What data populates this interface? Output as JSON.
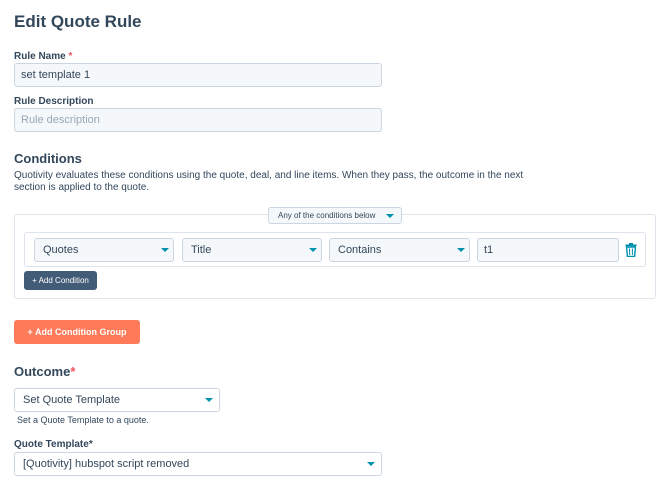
{
  "page": {
    "title": "Edit Quote Rule"
  },
  "rule_name": {
    "label": "Rule Name",
    "required_mark": "*",
    "value": "set template 1"
  },
  "rule_description": {
    "label": "Rule Description",
    "placeholder": "Rule description"
  },
  "conditions": {
    "heading": "Conditions",
    "description_line1": "Quotivity evaluates these conditions using the quote, deal, and line items. When they pass, the outcome in the next",
    "description_line2": "section is applied to the quote.",
    "group": {
      "match_selector": "Any of the conditions below",
      "row": {
        "object": "Quotes",
        "property": "Title",
        "operator": "Contains",
        "value": "t1"
      },
      "add_condition_label": "+ Add Condition"
    },
    "add_group_label": "+ Add Condition Group"
  },
  "outcome": {
    "heading": "Outcome",
    "required_mark": "*",
    "selected": "Set Quote Template",
    "help_text": "Set a Quote Template to a quote.",
    "quote_template": {
      "label": "Quote Template*",
      "selected": "[Quotivity] hubspot script removed"
    }
  },
  "colors": {
    "accent": "#0091ae",
    "primary_button": "#425b76",
    "cta_button": "#ff7a59",
    "required": "#f2545b"
  },
  "icons": {
    "dropdown": "chevron-down-icon",
    "delete": "trash-icon"
  }
}
